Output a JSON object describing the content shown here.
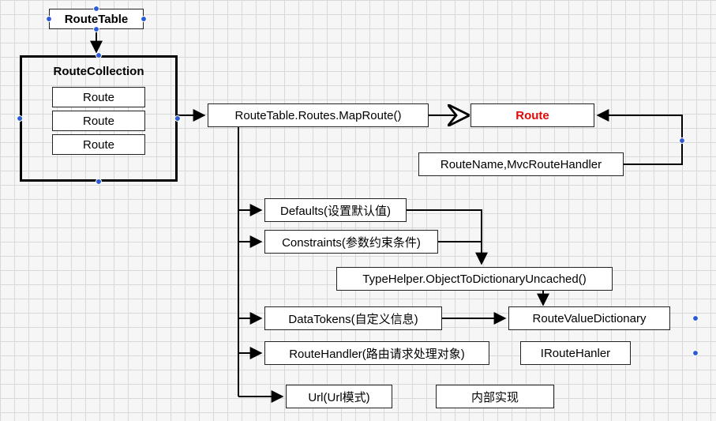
{
  "diagram": {
    "routeTable": "RouteTable",
    "routeCollection": "RouteCollection",
    "routes": [
      "Route",
      "Route",
      "Route"
    ],
    "mapRoute": "RouteTable.Routes.MapRoute()",
    "routeMain": "Route",
    "routeMeta": "RouteName,MvcRouteHandler",
    "defaults": "Defaults(设置默认值)",
    "constraints": "Constraints(参数约束条件)",
    "typeHelper": "TypeHelper.ObjectToDictionaryUncached()",
    "dataTokens": "DataTokens(自定义信息)",
    "routeValueDict": "RouteValueDictionary",
    "routeHandler": "RouteHandler(路由请求处理对象)",
    "iRouteHandler": "IRouteHanler",
    "url": "Url(Url模式)",
    "inner": "内部实现"
  }
}
